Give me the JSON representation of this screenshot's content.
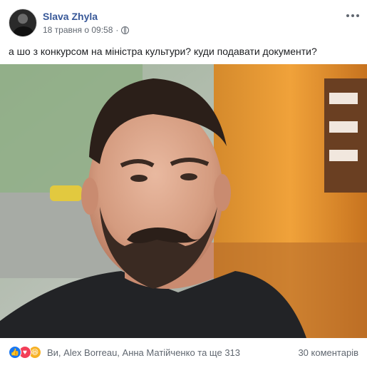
{
  "post": {
    "author": "Slava Zhyla",
    "date": "18 травня о 09:58",
    "separator": "·",
    "text": "а шо з конкурсом на міністра культури? куди подавати документи?",
    "privacy_icon": "globe-icon",
    "menu_icon": "more-horizontal-icon"
  },
  "footer": {
    "reactions_summary": "Ви, Alex Borreau, Анна Матійченко та ще 313",
    "comments_count": "30 коментарів",
    "reaction_icons": [
      "like-icon",
      "love-icon",
      "haha-icon"
    ]
  },
  "colors": {
    "author_link": "#385898",
    "meta": "#606770",
    "like": "#1877f2",
    "love": "#f33e58",
    "haha": "#f7b125"
  }
}
